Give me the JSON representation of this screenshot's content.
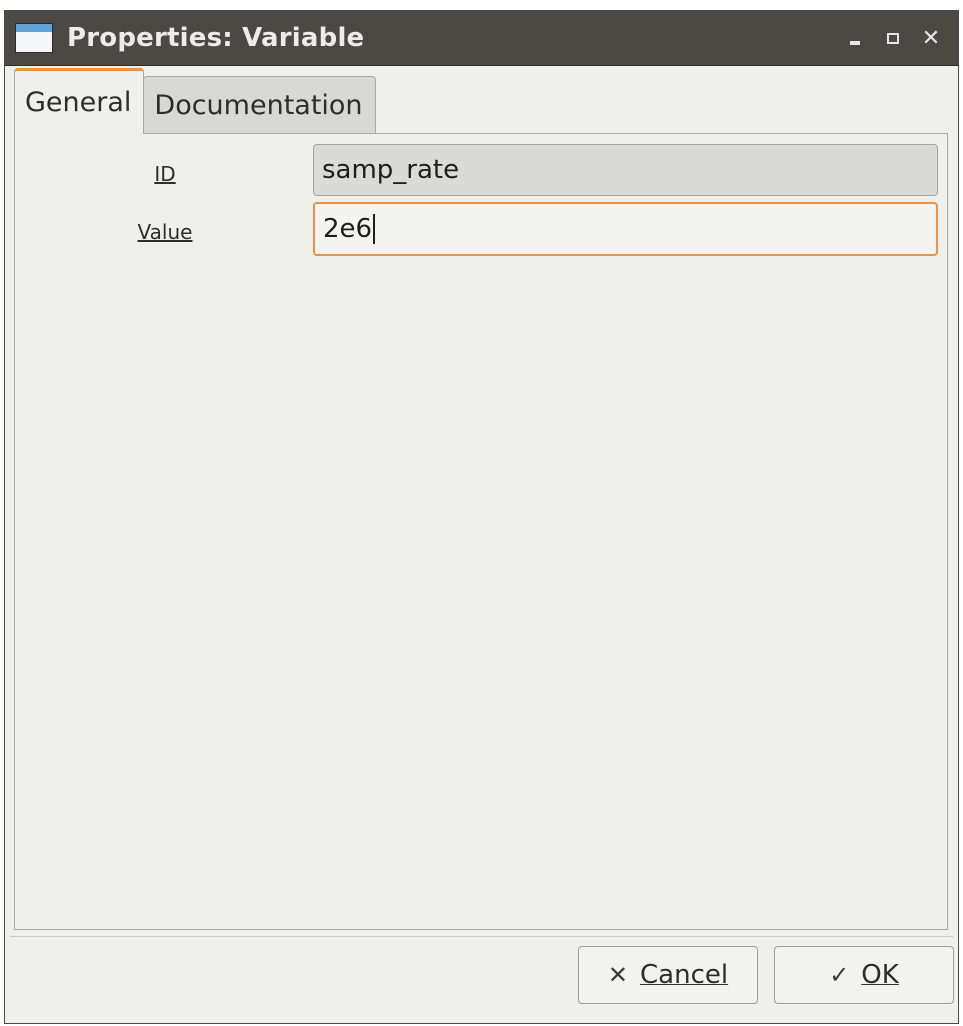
{
  "window": {
    "title": "Properties: Variable",
    "controls": {
      "minimize_icon": "minimize-icon",
      "maximize_icon": "maximize-icon",
      "close_icon": "close-icon",
      "close_glyph": "✕"
    }
  },
  "tabs": [
    {
      "label": "General",
      "active": true
    },
    {
      "label": "Documentation",
      "active": false
    }
  ],
  "form": {
    "id_label": "ID",
    "id_value": "samp_rate",
    "value_label": "Value",
    "value_value": "2e6"
  },
  "buttons": {
    "cancel": {
      "label": "Cancel",
      "icon": "✕"
    },
    "ok": {
      "label": "OK",
      "icon": "✓"
    }
  },
  "colors": {
    "accent": "#f0913d",
    "titlebar": "#4a4944",
    "background": "#efefec"
  }
}
